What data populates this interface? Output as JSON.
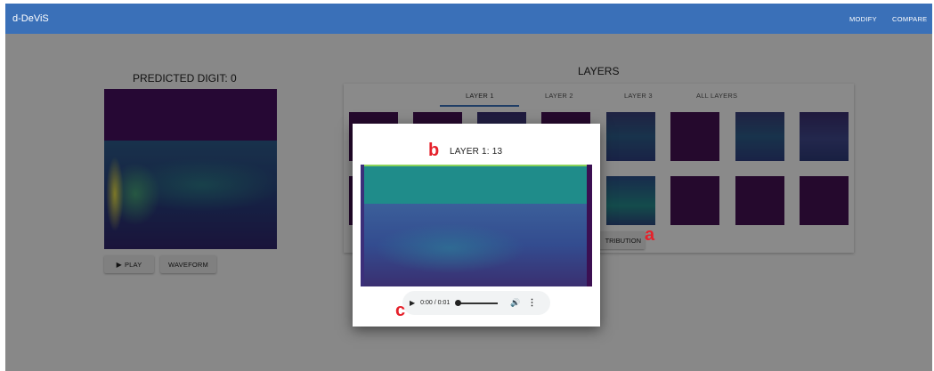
{
  "appbar": {
    "title": "d-DeViS",
    "modify": "MODIFY",
    "compare": "COMPARE"
  },
  "left": {
    "predicted_title": "PREDICTED DIGIT: 0",
    "play_label": "PLAY",
    "waveform_label": "WAVEFORM"
  },
  "layers": {
    "title": "LAYERS",
    "tabs": [
      "LAYER 1",
      "LAYER 2",
      "LAYER 3",
      "ALL LAYERS"
    ],
    "active_tab": "LAYER 1",
    "attribution_visible_text": "TRIBUTION"
  },
  "dialog": {
    "title": "LAYER 1: 13"
  },
  "audio": {
    "time": "0:00 / 0:01"
  },
  "markers": {
    "a": "a",
    "b": "b",
    "c": "c"
  },
  "icons": {
    "play": "play-icon",
    "volume": "volume-icon",
    "more": "more-vert-icon"
  },
  "colors": {
    "appbar": "#3a70b8",
    "marker": "#e5212b"
  }
}
